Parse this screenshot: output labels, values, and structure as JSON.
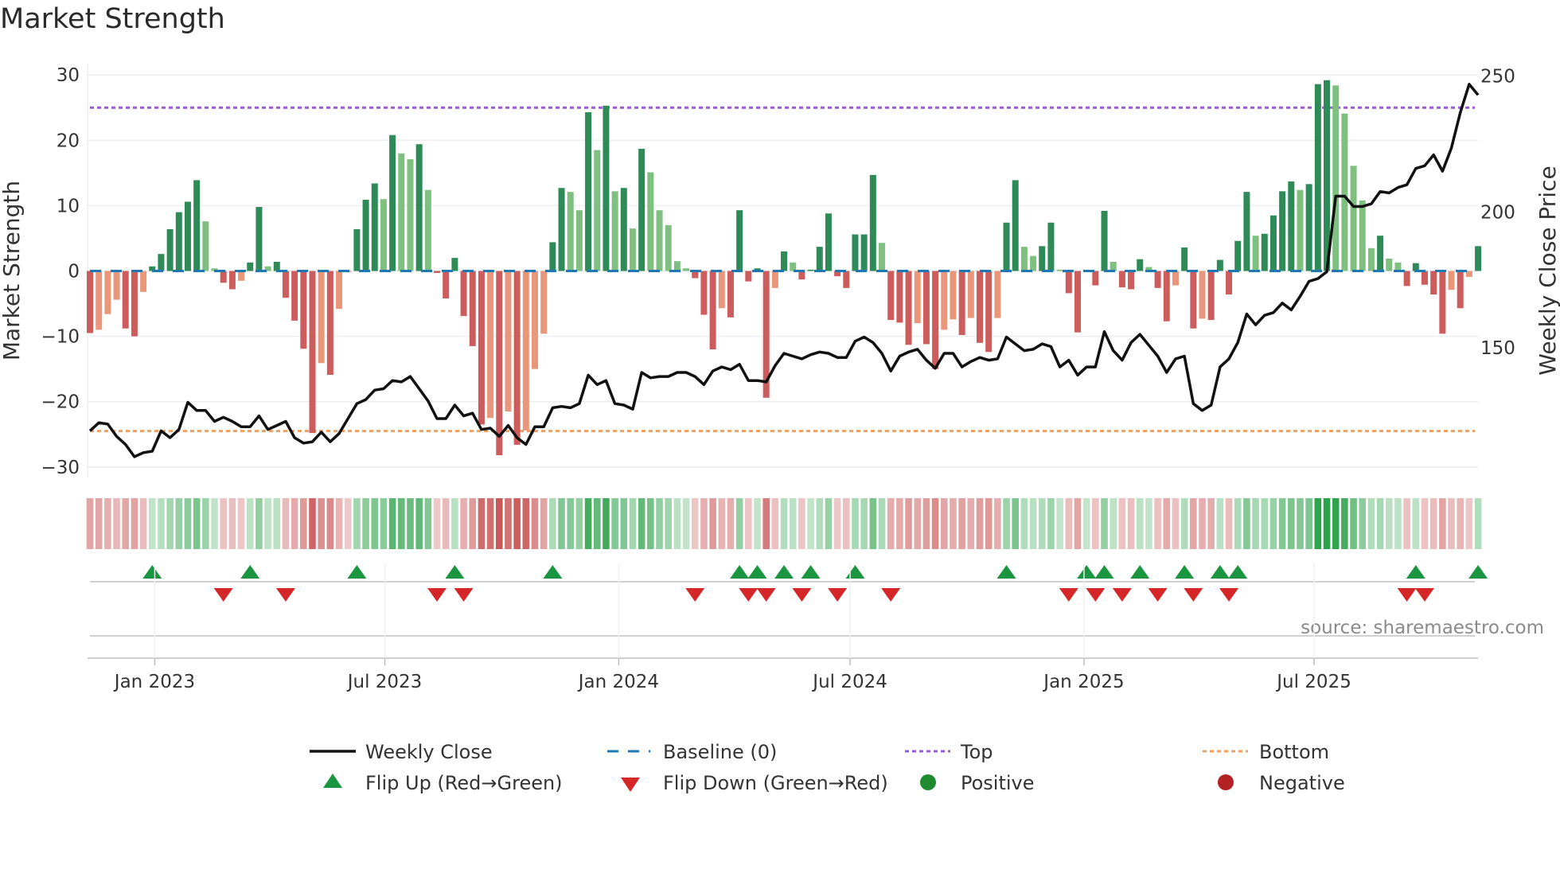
{
  "chart_data": {
    "type": "bar",
    "title": "Market Strength",
    "ylabel": "Market Strength",
    "ylabel_right": "Weekly Close Price",
    "ylim": [
      -31.5,
      32
    ],
    "yticks": [
      30,
      20,
      10,
      0,
      -10,
      -20,
      -30
    ],
    "yticks_right": [
      250,
      200,
      150
    ],
    "price_lim": [
      100,
      254
    ],
    "xticks": [
      {
        "label": "Jan 2023",
        "date": "2023-01-01"
      },
      {
        "label": "Jul 2023",
        "date": "2023-07-01"
      },
      {
        "label": "Jan 2024",
        "date": "2024-01-01"
      },
      {
        "label": "Jul 2024",
        "date": "2024-07-01"
      },
      {
        "label": "Jan 2025",
        "date": "2025-01-01"
      },
      {
        "label": "Jul 2025",
        "date": "2025-07-01"
      }
    ],
    "start_week": "2022-11-11",
    "interval_days": 7,
    "strength": [
      -9.5,
      -9,
      -6.6,
      -4.4,
      -8.8,
      -10,
      -3.2,
      0.7,
      2.6,
      6.4,
      9,
      10.6,
      13.9,
      7.6,
      0.4,
      -1.8,
      -2.8,
      -1.5,
      1.3,
      9.8,
      0.7,
      1.4,
      -4.1,
      -7.6,
      -11.9,
      -24.8,
      -14.1,
      -15.9,
      -5.8,
      -0.2,
      6.4,
      10.9,
      13.4,
      11,
      20.8,
      18,
      17.1,
      19.4,
      12.4,
      -0.3,
      -4.2,
      2,
      -6.9,
      -11.5,
      -23.5,
      -22.5,
      -28.2,
      -21.5,
      -26.6,
      -24.4,
      -15,
      -9.6,
      4.4,
      12.7,
      12.1,
      9.3,
      24.3,
      18.5,
      25.3,
      12.2,
      12.7,
      6.5,
      18.7,
      15.1,
      9.3,
      7,
      1.5,
      0.4,
      -1.1,
      -6.7,
      -12,
      -5.7,
      -7.1,
      9.3,
      -1.6,
      0.4,
      -19.4,
      -2.6,
      3,
      1.3,
      -1.3,
      0.2,
      3.7,
      8.8,
      -0.8,
      -2.6,
      5.6,
      5.6,
      14.7,
      4.3,
      -7.5,
      -7.9,
      -11.3,
      -8,
      -11.2,
      -15,
      -9,
      -7.4,
      -9.8,
      -7.2,
      -11,
      -12.4,
      -7.2,
      7.4,
      13.9,
      3.7,
      2.3,
      3.8,
      7.4,
      0.2,
      -3.4,
      -9.4,
      0.1,
      -2.2,
      9.2,
      1.4,
      -2.5,
      -2.8,
      1.8,
      0.6,
      -2.6,
      -7.7,
      -2.2,
      3.6,
      -8.8,
      -7.3,
      -7.5,
      1.7,
      -3.6,
      4.6,
      12.1,
      5.4,
      5.7,
      8.5,
      12.2,
      13.7,
      12.4,
      13.3,
      28.6,
      29.2,
      28.4,
      24.1,
      16.1,
      10.8,
      3.5,
      5.4,
      1.9,
      1.3,
      -2.3,
      1.2,
      -2.1,
      -3.6,
      -9.6,
      -2.9,
      -5.7,
      -0.9,
      3.8
    ],
    "weekly_close": [
      119.5,
      122.5,
      122,
      117.5,
      114.5,
      110,
      111.5,
      112,
      119.5,
      117,
      120,
      130,
      127,
      127,
      123,
      124.5,
      123,
      121,
      121,
      125,
      120,
      121.5,
      123,
      117,
      115,
      115.5,
      119,
      115.5,
      118.5,
      124,
      129.5,
      131,
      134.5,
      135,
      138,
      137.5,
      139.5,
      135,
      130.5,
      124,
      124,
      129,
      125,
      126,
      120,
      120.5,
      117.5,
      121.5,
      117,
      114.5,
      121,
      121,
      128,
      128.5,
      128,
      129.5,
      140,
      136.5,
      138,
      129.5,
      129,
      127.5,
      141,
      139,
      139.5,
      139.5,
      141,
      141,
      139.5,
      136.5,
      141.5,
      143,
      142,
      144,
      138,
      138,
      137.5,
      143.5,
      148,
      147,
      146,
      147.5,
      148.5,
      148,
      146.5,
      146.5,
      152.5,
      154,
      152,
      148,
      141.5,
      147,
      148.5,
      149.5,
      145.5,
      142.5,
      148,
      148,
      143,
      145,
      146.5,
      145.5,
      146,
      154,
      151.5,
      149,
      149.5,
      151.5,
      150.5,
      143,
      145.5,
      140,
      143,
      143,
      156,
      149,
      145.5,
      152,
      155,
      151,
      147,
      141,
      146,
      147,
      129.5,
      127,
      129,
      143,
      146,
      152,
      162.5,
      158.5,
      162,
      163,
      166.5,
      164,
      169,
      174.5,
      175.5,
      178,
      205.8,
      205.8,
      202,
      202,
      203,
      207.5,
      207,
      209,
      210,
      216,
      217,
      221,
      215,
      223.5,
      236.5,
      247,
      243
    ],
    "flip_up_weeks": [
      7,
      18,
      30,
      41,
      52,
      73,
      75,
      78,
      81,
      86,
      103,
      112,
      114,
      118,
      123,
      127,
      129,
      149,
      156
    ],
    "flip_down_weeks": [
      15,
      22,
      39,
      42,
      68,
      74,
      76,
      80,
      84,
      90,
      110,
      113,
      116,
      120,
      124,
      128,
      148,
      150
    ],
    "top_level": 25,
    "bottom_level": -24.5,
    "baseline": 0,
    "legend_placement": "bottom",
    "legend": {
      "weekly_close": "Weekly Close",
      "baseline": "Baseline (0)",
      "top": "Top",
      "bottom": "Bottom",
      "flip_up": "Flip Up (Red→Green)",
      "flip_down": "Flip Down (Green→Red)",
      "positive": "Positive",
      "negative": "Negative"
    },
    "source": "source: sharemaestro.com",
    "colors": {
      "pos_rising": "#2e8b57",
      "pos_falling": "#7fbf7f",
      "neg_falling": "#cd5c5c",
      "neg_rising": "#e9967a",
      "close": "#111111",
      "baseline": "#1f77b4",
      "top": "#9b59d6",
      "bottom": "#f0a060",
      "flip_up": "#1a9641",
      "flip_down": "#d62728",
      "positive": "#1e8c2e",
      "negative": "#b22222"
    }
  }
}
